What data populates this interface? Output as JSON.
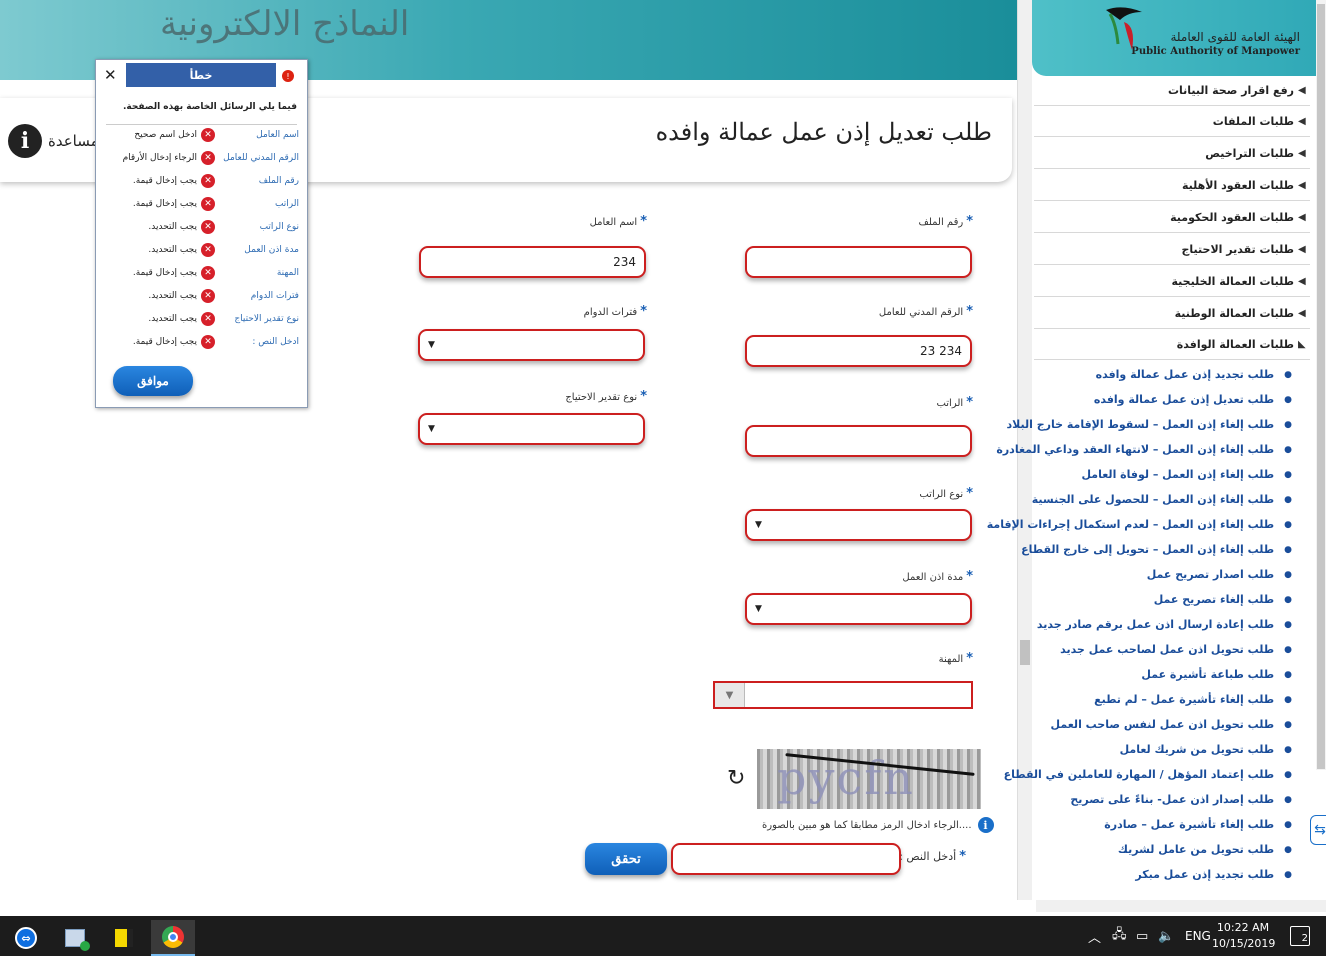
{
  "banner": {
    "title": "النماذج الالكترونية"
  },
  "page": {
    "title": "طلب تعديل إذن عمل عمالة وافده",
    "help_label": "مساعدة",
    "help_icon": "i"
  },
  "form": {
    "required_mark": "*",
    "file_number": {
      "label": "رقم الملف",
      "value": ""
    },
    "worker_name": {
      "label": "اسم العامل",
      "value": "234"
    },
    "civil_id": {
      "label": "الرقم المدني للعامل",
      "value": "234 23"
    },
    "shifts": {
      "label": "فترات الدوام",
      "value": ""
    },
    "salary": {
      "label": "الراتب",
      "value": ""
    },
    "need_estimate_type": {
      "label": "نوع تقدير الاحتياج",
      "value": ""
    },
    "salary_type": {
      "label": "نوع الراتب",
      "value": ""
    },
    "permit_duration": {
      "label": "مدة اذن العمل",
      "value": ""
    },
    "profession": {
      "label": "المهنة",
      "value": ""
    },
    "captcha": {
      "image_text": "pycfn",
      "hint": "....الرجاء ادخال الرمز مطابقا كما هو مبين بالصورة",
      "input_label": "أدخل النص :",
      "input_value": "",
      "verify_label": "تحقق"
    }
  },
  "error_dialog": {
    "title": "خطأ",
    "intro": "فيما يلي الرسائل الخاصة بهذه الصفحة.",
    "ok_label": "موافق",
    "errors": [
      {
        "field": "اسم العامل",
        "message": "ادخل اسم صحيح"
      },
      {
        "field": "الرقم المدني للعامل",
        "message": "الرجاء إدخال الأرقام"
      },
      {
        "field": "رقم الملف",
        "message": "يجب إدخال قيمة."
      },
      {
        "field": "الراتب",
        "message": "يجب إدخال قيمة."
      },
      {
        "field": "نوع الراتب",
        "message": "يجب التحديد."
      },
      {
        "field": "مدة اذن العمل",
        "message": "يجب التحديد."
      },
      {
        "field": "المهنة",
        "message": "يجب إدخال قيمة."
      },
      {
        "field": "فترات الدوام",
        "message": "يجب التحديد."
      },
      {
        "field": "نوع تقدير الاحتياج",
        "message": "يجب التحديد."
      },
      {
        "field": "أدخل النص :",
        "message": "يجب إدخال قيمة."
      }
    ]
  },
  "sidebar": {
    "logo_ar": "الهيئة العامة للقوى العاملة",
    "logo_en": "Public Authority of Manpower",
    "menu": [
      {
        "label": "رفع اقرار صحة البيانات"
      },
      {
        "label": "طلبات الملفات"
      },
      {
        "label": "طلبات التراخيص"
      },
      {
        "label": "طلبات العقود الأهلية"
      },
      {
        "label": "طلبات العقود الحكومية"
      },
      {
        "label": "طلبات تقدير الاحتياج"
      },
      {
        "label": "طلبات العمالة الخليجية"
      },
      {
        "label": "طلبات العمالة الوطنية"
      },
      {
        "label": "طلبات العمالة الوافدة"
      }
    ],
    "submenu": [
      {
        "label": "طلب تجديد إذن عمل عمالة وافده"
      },
      {
        "label": "طلب تعديل إذن عمل عمالة وافده"
      },
      {
        "label": "طلب إلغاء إذن العمل – لسقوط الإقامة خارج البلاد"
      },
      {
        "label": "طلب إلغاء إذن العمل – لانتهاء العقد وداعي المغادرة"
      },
      {
        "label": "طلب إلغاء إذن العمل – لوفاة العامل"
      },
      {
        "label": "طلب إلغاء إذن العمل – للحصول على الجنسية"
      },
      {
        "label": "طلب إلغاء إذن العمل – لعدم استكمال إجراءات الإقامة"
      },
      {
        "label": "طلب إلغاء إذن العمل – تحويل إلى خارج القطاع"
      },
      {
        "label": "طلب اصدار تصريح عمل"
      },
      {
        "label": "طلب إلغاء تصريح عمل"
      },
      {
        "label": "طلب إعادة ارسال اذن عمل برقم صادر جديد"
      },
      {
        "label": "طلب تحويل اذن عمل لصاحب عمل جديد"
      },
      {
        "label": "طلب طباعة تأشيرة عمل"
      },
      {
        "label": "طلب إلغاء تأشيرة عمل – لم تطبع"
      },
      {
        "label": "طلب تحويل اذن عمل لنفس صاحب العمل"
      },
      {
        "label": "طلب تحويل من شريك لعامل"
      },
      {
        "label": "طلب إعتماد المؤهل / المهارة للعاملين في القطاع"
      },
      {
        "label": "طلب إصدار اذن عمل- بناءً على تصريح"
      },
      {
        "label": "طلب إلغاء تأشيرة عمل – صادرة"
      },
      {
        "label": "طلب تحويل من عامل لشريك"
      },
      {
        "label": "طلب تجديد إذن عمل مبكر"
      }
    ]
  },
  "taskbar": {
    "language": "ENG",
    "time": "10:22 AM",
    "date": "10/15/2019",
    "notifications": "2"
  },
  "colors": {
    "accent_blue": "#1565c0",
    "error_red": "#cc1f1f",
    "banner_teal": "#2fa8b6"
  }
}
